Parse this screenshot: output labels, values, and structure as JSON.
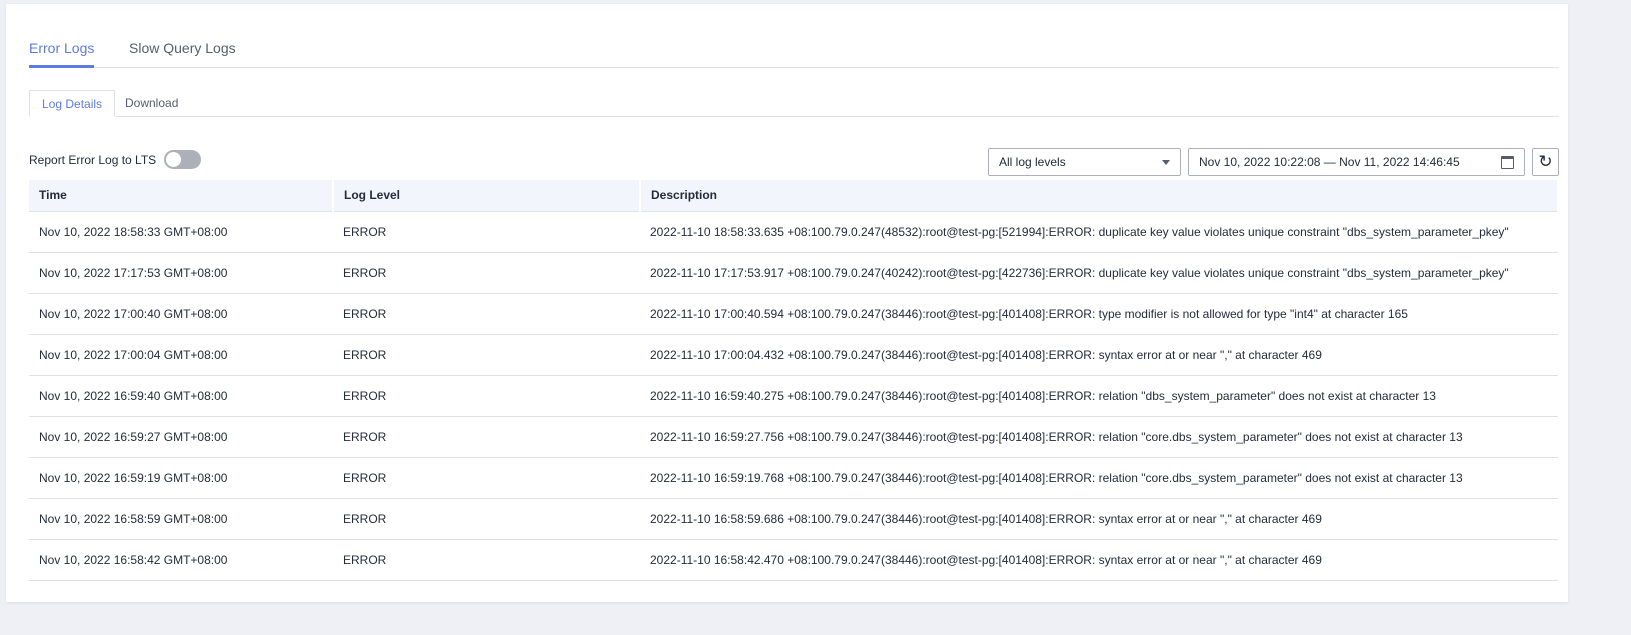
{
  "tabs": [
    "Error Logs",
    "Slow Query Logs"
  ],
  "subtabs": [
    "Log Details",
    "Download"
  ],
  "lts_label": "Report Error Log to LTS",
  "lts_enabled": false,
  "level_select": "All log levels",
  "date_range": "Nov 10, 2022 10:22:08 — Nov 11, 2022 14:46:45",
  "accent_color": "#5e7ce0",
  "table": {
    "columns": [
      "Time",
      "Log Level",
      "Description"
    ],
    "rows": [
      [
        "Nov 10, 2022 18:58:33 GMT+08:00",
        "ERROR",
        "2022-11-10 18:58:33.635 +08:100.79.0.247(48532):root@test-pg:[521994]:ERROR: duplicate key value violates unique constraint \"dbs_system_parameter_pkey\""
      ],
      [
        "Nov 10, 2022 17:17:53 GMT+08:00",
        "ERROR",
        "2022-11-10 17:17:53.917 +08:100.79.0.247(40242):root@test-pg:[422736]:ERROR: duplicate key value violates unique constraint \"dbs_system_parameter_pkey\""
      ],
      [
        "Nov 10, 2022 17:00:40 GMT+08:00",
        "ERROR",
        "2022-11-10 17:00:40.594 +08:100.79.0.247(38446):root@test-pg:[401408]:ERROR: type modifier is not allowed for type \"int4\" at character 165"
      ],
      [
        "Nov 10, 2022 17:00:04 GMT+08:00",
        "ERROR",
        "2022-11-10 17:00:04.432 +08:100.79.0.247(38446):root@test-pg:[401408]:ERROR: syntax error at or near \",\" at character 469"
      ],
      [
        "Nov 10, 2022 16:59:40 GMT+08:00",
        "ERROR",
        "2022-11-10 16:59:40.275 +08:100.79.0.247(38446):root@test-pg:[401408]:ERROR: relation \"dbs_system_parameter\" does not exist at character 13"
      ],
      [
        "Nov 10, 2022 16:59:27 GMT+08:00",
        "ERROR",
        "2022-11-10 16:59:27.756 +08:100.79.0.247(38446):root@test-pg:[401408]:ERROR: relation \"core.dbs_system_parameter\" does not exist at character 13"
      ],
      [
        "Nov 10, 2022 16:59:19 GMT+08:00",
        "ERROR",
        "2022-11-10 16:59:19.768 +08:100.79.0.247(38446):root@test-pg:[401408]:ERROR: relation \"core.dbs_system_parameter\" does not exist at character 13"
      ],
      [
        "Nov 10, 2022 16:58:59 GMT+08:00",
        "ERROR",
        "2022-11-10 16:58:59.686 +08:100.79.0.247(38446):root@test-pg:[401408]:ERROR: syntax error at or near \",\" at character 469"
      ],
      [
        "Nov 10, 2022 16:58:42 GMT+08:00",
        "ERROR",
        "2022-11-10 16:58:42.470 +08:100.79.0.247(38446):root@test-pg:[401408]:ERROR: syntax error at or near \",\" at character 469"
      ]
    ]
  }
}
